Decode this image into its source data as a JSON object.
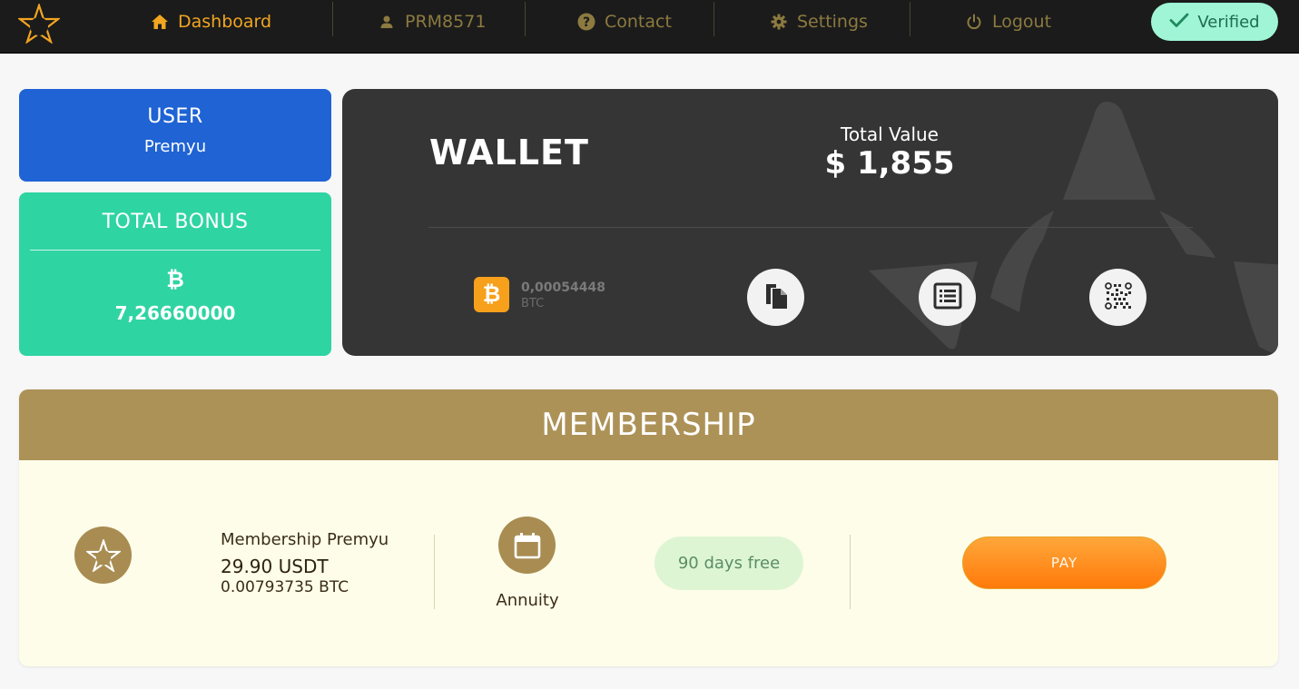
{
  "nav": {
    "items": [
      {
        "label": "Dashboard",
        "icon": "home-icon",
        "active": true
      },
      {
        "label": "PRM8571",
        "icon": "user-icon",
        "active": false
      },
      {
        "label": "Contact",
        "icon": "help-icon",
        "active": false
      },
      {
        "label": "Settings",
        "icon": "gear-icon",
        "active": false
      },
      {
        "label": "Logout",
        "icon": "power-icon",
        "active": false
      }
    ],
    "verified_label": "Verified"
  },
  "user_card": {
    "heading": "USER",
    "value": "Premyu"
  },
  "bonus_card": {
    "heading": "TOTAL BONUS",
    "symbol": "₿",
    "value": "7,26660000"
  },
  "wallet": {
    "title": "WALLET",
    "total_label": "Total Value",
    "total_value": "$ 1,855",
    "btc_amount": "0,00054448",
    "btc_unit": "BTC",
    "actions": [
      "copy-icon",
      "list-icon",
      "qr-code-icon"
    ]
  },
  "membership": {
    "heading": "MEMBERSHIP",
    "plan_name": "Membership Premyu",
    "price_usdt": "29.90 USDT",
    "price_btc": "0.00793735 BTC",
    "period_label": "Annuity",
    "free_label": "90 days free",
    "pay_label": "PAY"
  },
  "colors": {
    "accent": "#f1a521",
    "nav_bg": "#1b1b1b",
    "user_card": "#1f63d4",
    "bonus_card": "#2fd4a3",
    "wallet_bg": "#353535",
    "membership_head": "#ad9258",
    "pay_button": "#ff8a18"
  }
}
